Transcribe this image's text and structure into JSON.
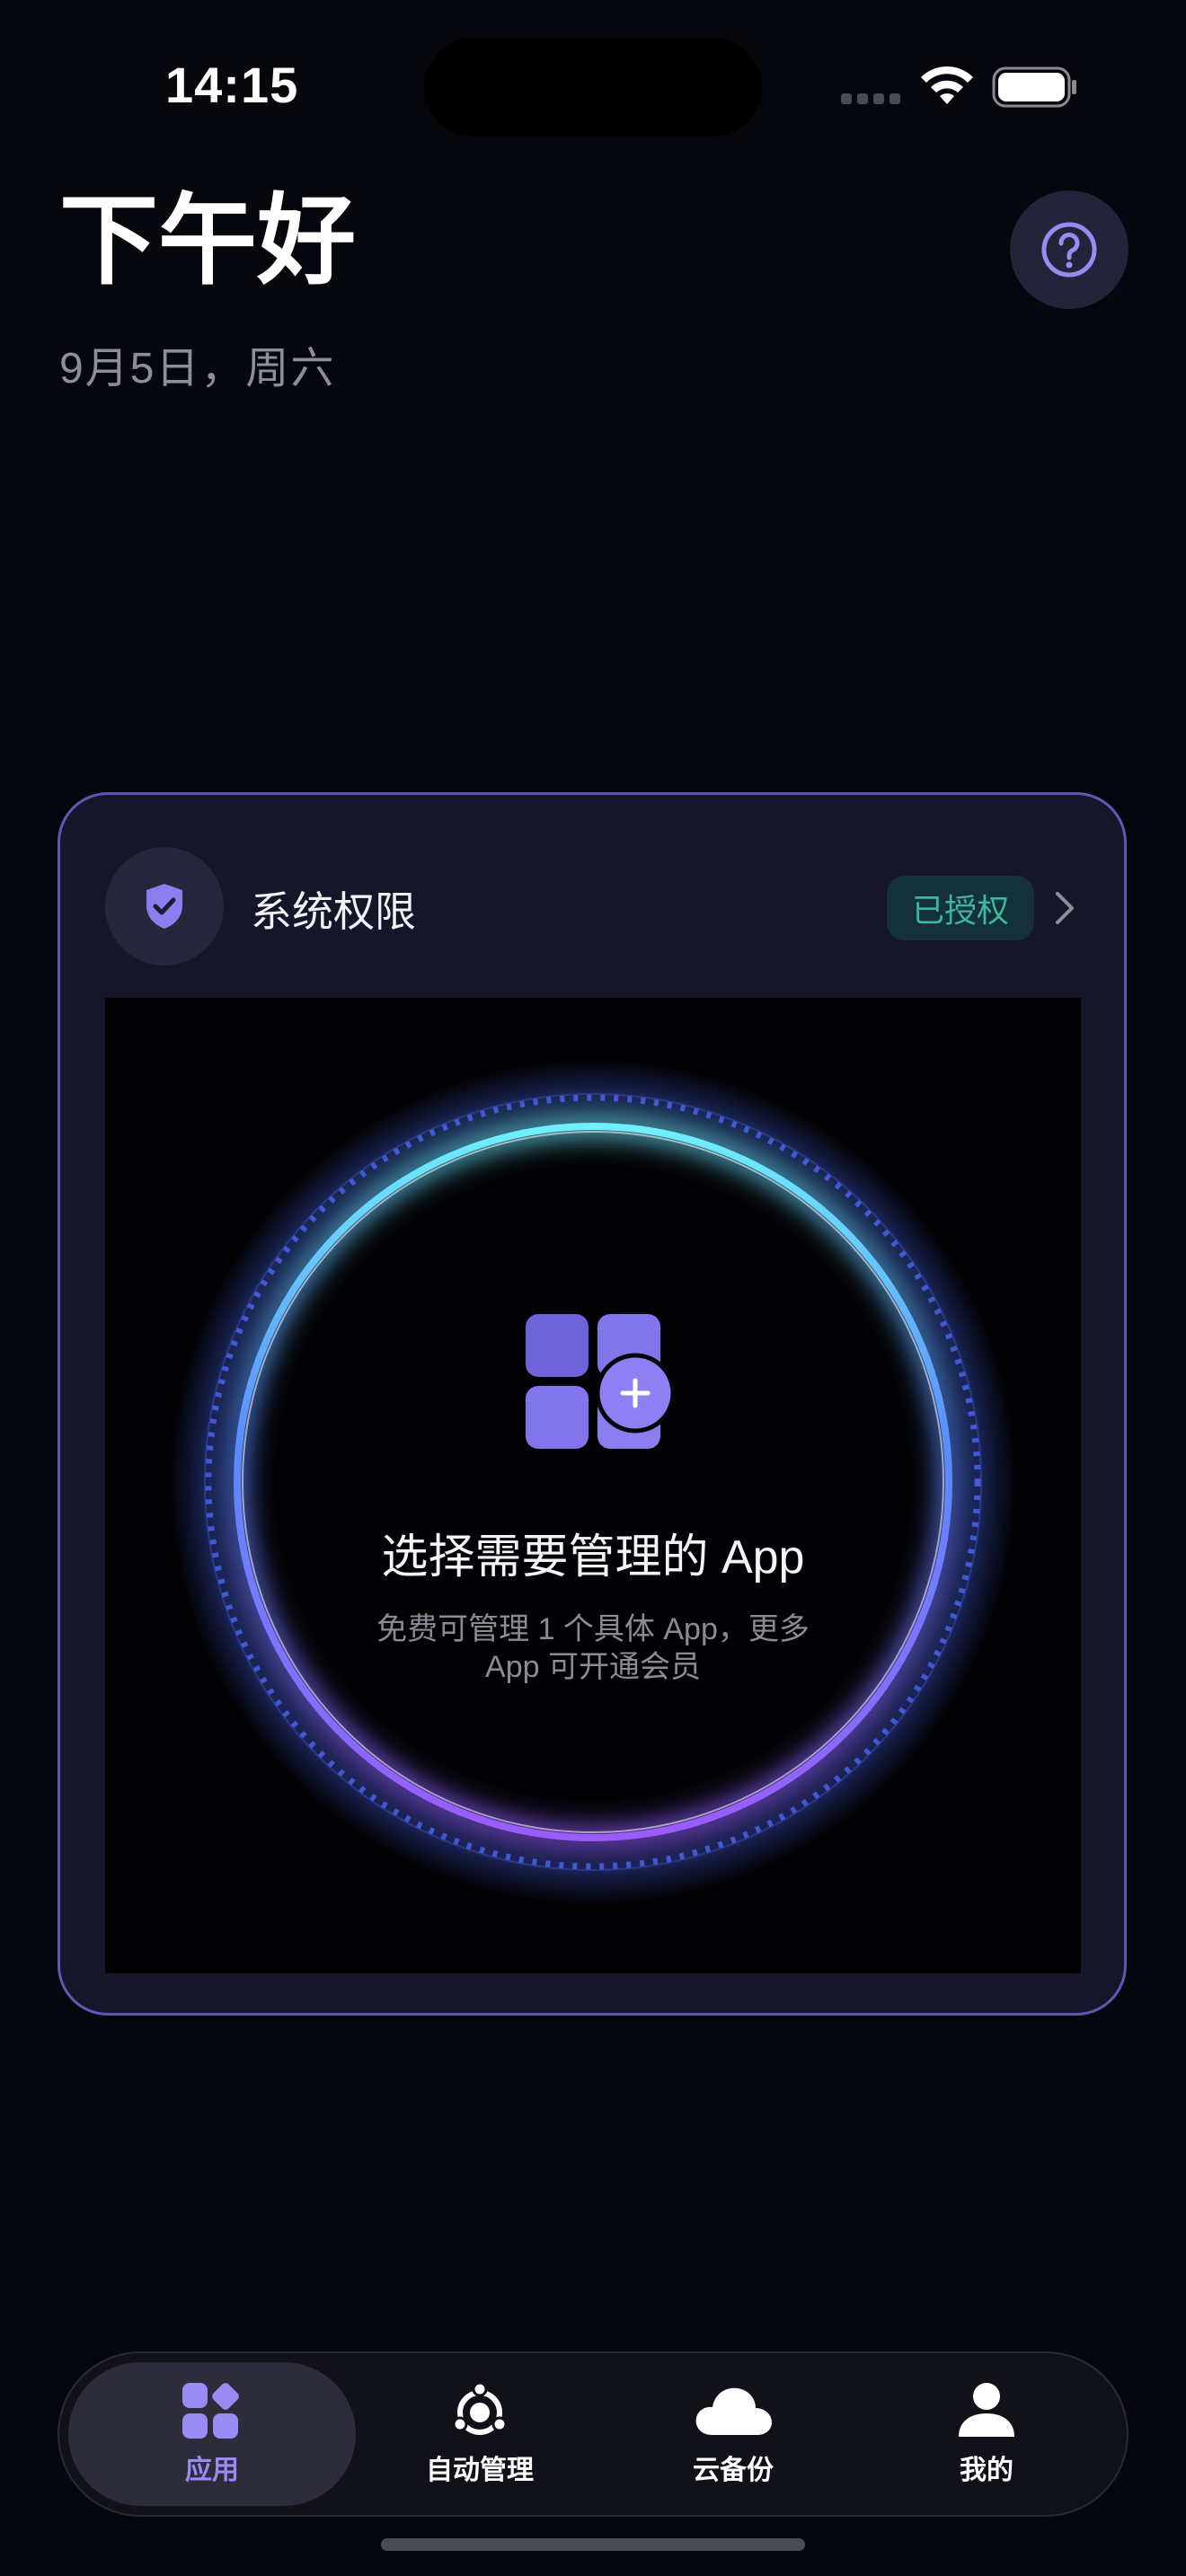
{
  "status_bar": {
    "time": "14:15"
  },
  "header": {
    "greeting": "下午好",
    "date": "9月5日，周六",
    "help_icon": "question-circle-icon"
  },
  "permission": {
    "title": "系统权限",
    "badge": "已授权",
    "badge_color": "#3bb79b",
    "icon": "shield-check-icon"
  },
  "app_select": {
    "title": "选择需要管理的 App",
    "subtitle": "免费可管理 1 个具体 App，更多 App 可开通会员",
    "icon": "apps-add-icon"
  },
  "tab_bar": {
    "active_index": 0,
    "items": [
      {
        "label": "应用",
        "icon": "apps-grid-icon"
      },
      {
        "label": "自动管理",
        "icon": "auto-manage-icon"
      },
      {
        "label": "云备份",
        "icon": "cloud-icon"
      },
      {
        "label": "我的",
        "icon": "person-icon"
      }
    ]
  },
  "colors": {
    "accent": "#9a8bf2",
    "background": "#06060d",
    "card_border": "#5d58b4"
  }
}
